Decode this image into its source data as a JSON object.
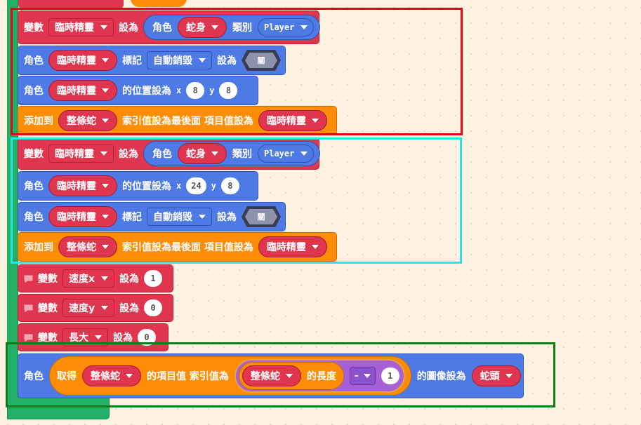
{
  "colors": {
    "variables": "#e0354f",
    "sprites": "#4e7ae6",
    "arrays": "#fd8c06",
    "math": "#a761d6",
    "loop_green": "#22b066",
    "frame_red": "#e3061b",
    "frame_cyan": "#27e6e6",
    "frame_green": "#127c1a"
  },
  "group1": {
    "set_var": {
      "kw1": "變數",
      "var": "臨時精靈",
      "kw2": "設為",
      "sprite_kw": "角色",
      "image": "蛇身",
      "kw3": "類別",
      "kind": "Player"
    },
    "set_flag": {
      "kw1": "角色",
      "var": "臨時精靈",
      "kw2": "標記",
      "flag": "自動銷毀",
      "kw3": "設為",
      "bool": "關"
    },
    "set_pos": {
      "kw1": "角色",
      "var": "臨時精靈",
      "kw2": "的位置設為",
      "x_label": "x",
      "x": "8",
      "y_label": "y",
      "y": "8"
    },
    "push": {
      "kw1": "添加到",
      "array": "整條蛇",
      "kw2": "索引值設為最後面 項目值設為",
      "value": "臨時精靈"
    }
  },
  "group2": {
    "set_var": {
      "kw1": "變數",
      "var": "臨時精靈",
      "kw2": "設為",
      "sprite_kw": "角色",
      "image": "蛇身",
      "kw3": "類別",
      "kind": "Player"
    },
    "set_pos": {
      "kw1": "角色",
      "var": "臨時精靈",
      "kw2": "的位置設為",
      "x_label": "x",
      "x": "24",
      "y_label": "y",
      "y": "8"
    },
    "set_flag": {
      "kw1": "角色",
      "var": "臨時精靈",
      "kw2": "標記",
      "flag": "自動銷毀",
      "kw3": "設為",
      "bool": "關"
    },
    "push": {
      "kw1": "添加到",
      "array": "整條蛇",
      "kw2": "索引值設為最後面 項目值設為",
      "value": "臨時精靈"
    }
  },
  "vars": [
    {
      "kw1": "變數",
      "var": "速度x",
      "kw2": "設為",
      "value": "1"
    },
    {
      "kw1": "變數",
      "var": "速度y",
      "kw2": "設為",
      "value": "0"
    },
    {
      "kw1": "變數",
      "var": "長大",
      "kw2": "設為",
      "value": "0"
    }
  ],
  "final": {
    "kw1": "角色",
    "get_kw": "取得",
    "array": "整條蛇",
    "kw2": "的項目值 索引值為",
    "len_array": "整條蛇",
    "len_kw": "的長度",
    "op": "-",
    "operand": "1",
    "kw3": "的圖像設為",
    "image": "蛇頭"
  }
}
